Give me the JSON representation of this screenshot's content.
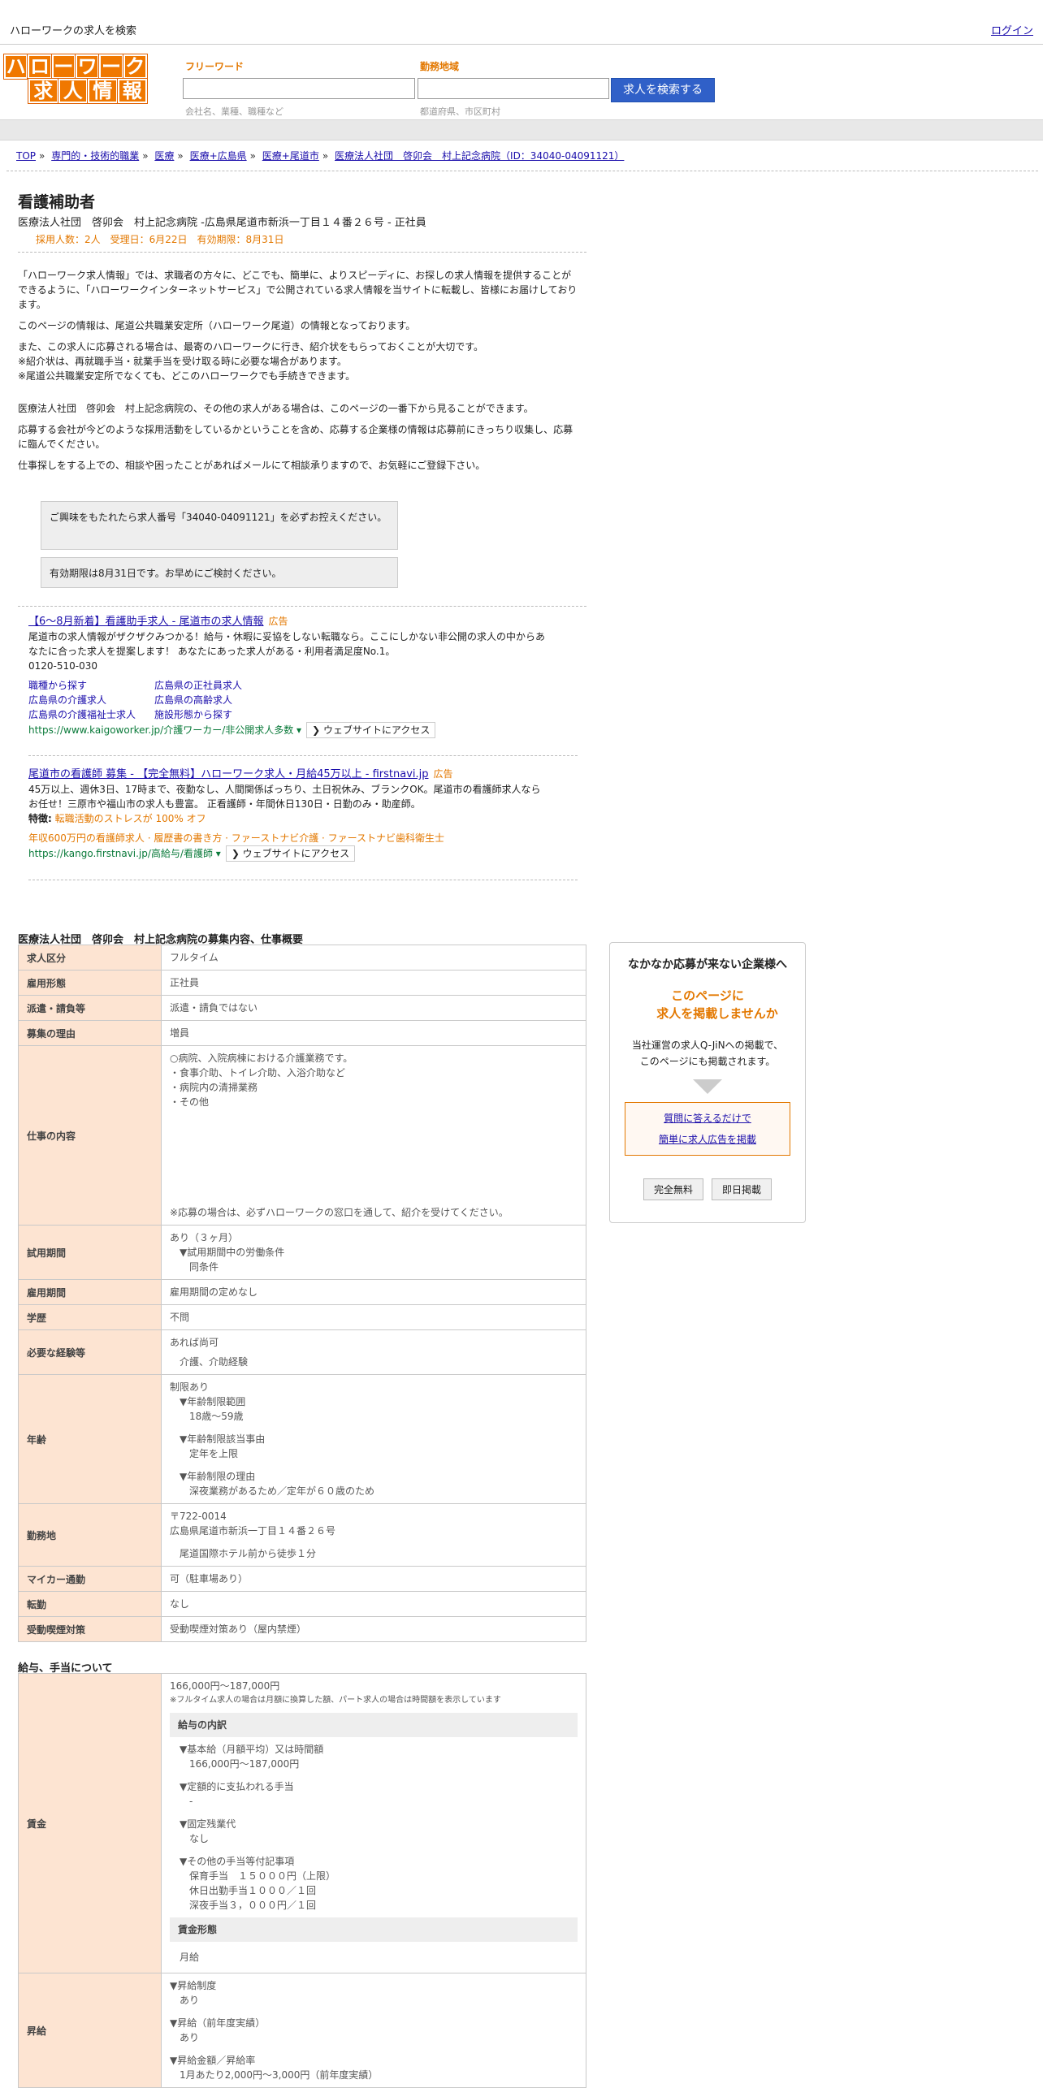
{
  "header": {
    "title": "ハローワークの求人を検索",
    "login": "ログイン"
  },
  "logo": {
    "row1": [
      "ハ",
      "ロ",
      "ー",
      "ワ",
      "ー",
      "ク"
    ],
    "row2": [
      "求",
      "人",
      "情",
      "報"
    ]
  },
  "search": {
    "freeword_label": "フリーワード",
    "freeword_hint": "会社名、業種、職種など",
    "area_label": "勤務地域",
    "area_hint": "都道府県、市区町村",
    "button": "求人を検索する"
  },
  "breadcrumb": [
    "TOP",
    "専門的・技術的職業",
    "医療",
    "医療+広島県",
    "医療+尾道市",
    "医療法人社団　啓卯会　村上記念病院（ID：34040-04091121）"
  ],
  "job": {
    "title": "看護補助者",
    "subtitle": "医療法人社団　啓卯会　村上記念病院 -広島県尾道市新浜一丁目１４番２６号 - 正社員",
    "meta": "採用人数：2人　受理日：6月22日　有効期限：8月31日"
  },
  "intro": {
    "p1": "「ハローワーク求人情報」では、求職者の方々に、どこでも、簡単に、よりスピーディに、お探しの求人情報を提供することができるように、「ハローワークインターネットサービス」で公開されている求人情報を当サイトに転載し、皆様にお届けしております。",
    "p2": "このページの情報は、尾道公共職業安定所（ハローワーク尾道）の情報となっております。",
    "p3a": "また、この求人に応募される場合は、最寄のハローワークに行き、紹介状をもらっておくことが大切です。",
    "p3b": "※紹介状は、再就職手当・就業手当を受け取る時に必要な場合があります。",
    "p3c": "※尾道公共職業安定所でなくても、どこのハローワークでも手続きできます。",
    "p4": "医療法人社団　啓卯会　村上記念病院の、その他の求人がある場合は、このページの一番下から見ることができます。",
    "p5": "応募する会社が今どのような採用活動をしているかということを含め、応募する企業様の情報は応募前にきっちり収集し、応募に臨んでください。",
    "p6": "仕事探しをする上での、相談や困ったことがあればメールにて相談承りますので、お気軽にご登録下さい。"
  },
  "notices": {
    "n1": "ご興味をもたれたら求人番号「34040-04091121」を必ずお控えください。",
    "n2": "有効期限は8月31日です。お早めにご検討ください。"
  },
  "ads": [
    {
      "title": "【6～8月新着】看護助手求人 - 尾道市の求人情報",
      "tag": "広告",
      "body": "尾道市の求人情報がザクザクみつかる！給与・休暇に妥協をしない転職なら。ここにしかない非公開の求人の中からあなたに合った求人を提案します！ あなたにあった求人がある・利用者満足度No.1。",
      "phone": "0120-510-030",
      "links": [
        "職種から探す",
        "広島県の正社員求人",
        "広島県の介護求人",
        "広島県の高齢求人",
        "広島県の介護福祉士求人",
        "施設形態から探す"
      ],
      "url": "https://www.kaigoworker.jp/介護ワーカー/非公開求人多数 ▾",
      "visit": "❯ ウェブサイトにアクセス"
    },
    {
      "title": "尾道市の看護師 募集 - 【完全無料】ハローワーク求人・月給45万以上 - firstnavi.jp",
      "tag": "広告",
      "body": "45万以上、週休3日、17時まで、夜勤なし、人間関係ばっちり、土日祝休み、ブランクOK。尾道市の看護師求人ならお任せ！三原市や福山市の求人も豊富。 正看護師・年間休日130日・日勤のみ・助産師。",
      "feature_label": "特徴:",
      "feature": "転職活動のストレスが 100% オフ",
      "links_line": "年収600万円の看護師求人 · 履歴書の書き方 · ファーストナビ介護 · ファーストナビ歯科衛生士",
      "url": "https://kango.firstnavi.jp/高給与/看護師 ▾",
      "visit": "❯ ウェブサイトにアクセス"
    }
  ],
  "section1": {
    "title": "医療法人社団　啓卯会　村上記念病院の募集内容、仕事概要",
    "rows": {
      "r1": {
        "k": "求人区分",
        "v": "フルタイム"
      },
      "r2": {
        "k": "雇用形態",
        "v": "正社員"
      },
      "r3": {
        "k": "派遣・請負等",
        "v": "派遣・請負ではない"
      },
      "r4": {
        "k": "募集の理由",
        "v": "増員"
      },
      "r5": {
        "k": "仕事の内容",
        "v1": "○病院、入院病棟における介護業務です。",
        "v2": "・食事介助、トイレ介助、入浴介助など",
        "v3": "・病院内の清掃業務",
        "v4": "・その他",
        "v5": "※応募の場合は、必ずハローワークの窓口を通して、紹介を受けてください。"
      },
      "r6": {
        "k": "試用期間",
        "v1": "あり（３ヶ月）",
        "v2": "▼試用期間中の労働条件",
        "v3": "同条件"
      },
      "r7": {
        "k": "雇用期間",
        "v": "雇用期間の定めなし"
      },
      "r8": {
        "k": "学歴",
        "v": "不問"
      },
      "r9": {
        "k": "必要な経験等",
        "v1": "あれば尚可",
        "v2": "介護、介助経験"
      },
      "r10": {
        "k": "年齢",
        "v1": "制限あり",
        "v2": "▼年齢制限範囲",
        "v3": "18歳～59歳",
        "v4": "▼年齢制限該当事由",
        "v5": "定年を上限",
        "v6": "▼年齢制限の理由",
        "v7": "深夜業務があるため／定年が６０歳のため"
      },
      "r11": {
        "k": "勤務地",
        "v1": "〒722-0014",
        "v2": "広島県尾道市新浜一丁目１４番２６号",
        "v3": "尾道国際ホテル前から徒歩１分"
      },
      "r12": {
        "k": "マイカー通勤",
        "v": "可（駐車場あり）"
      },
      "r13": {
        "k": "転勤",
        "v": "なし"
      },
      "r14": {
        "k": "受動喫煙対策",
        "v": "受動喫煙対策あり（屋内禁煙）"
      }
    }
  },
  "section2": {
    "title": "給与、手当について",
    "wage": {
      "k": "賃金",
      "range": "166,000円～187,000円",
      "note": "※フルタイム求人の場合は月額に換算した額、パート求人の場合は時間額を表示しています",
      "breakdown": "給与の内訳",
      "b1": "▼基本給（月額平均）又は時間額",
      "b1v": "166,000円～187,000円",
      "b2": "▼定額的に支払われる手当",
      "b2v": "-",
      "b3": "▼固定残業代",
      "b3v": "なし",
      "b4": "▼その他の手当等付記事項",
      "b4v1": "保育手当　１５０００円（上限）",
      "b4v2": "休日出勤手当１０００／１回",
      "b4v3": "深夜手当３，０００円／１回",
      "form": "賃金形態",
      "formv": "月給"
    },
    "raise": {
      "k": "昇給",
      "a1": "▼昇給制度",
      "a1v": "あり",
      "a2": "▼昇給（前年度実績）",
      "a2v": "あり",
      "a3": "▼昇給金額／昇給率",
      "a3v": "1月あたり2,000円～3,000円（前年度実績）"
    }
  },
  "aside": {
    "head": "なかなか応募が来ない企業様へ",
    "red1": "このページに",
    "red2": "求人を掲載しませんか",
    "txt1": "当社運営の求人Q-JiNへの掲載で、",
    "txt2": "このページにも掲載されます。",
    "link1": "質問に答えるだけで",
    "link2": "簡単に求人広告を掲載",
    "btn1": "完全無料",
    "btn2": "即日掲載"
  }
}
